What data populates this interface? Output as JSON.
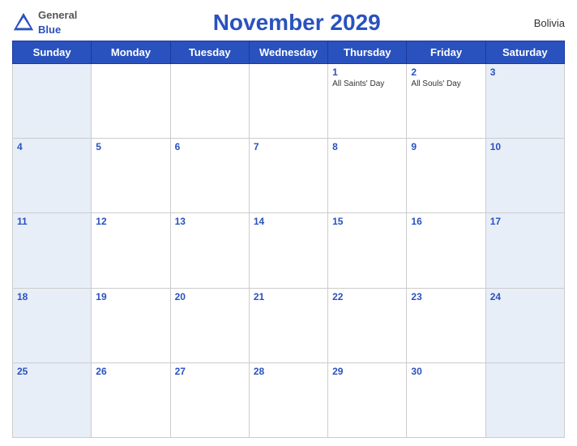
{
  "header": {
    "title": "November 2029",
    "country": "Bolivia",
    "logo": {
      "general": "General",
      "blue": "Blue"
    }
  },
  "weekdays": [
    "Sunday",
    "Monday",
    "Tuesday",
    "Wednesday",
    "Thursday",
    "Friday",
    "Saturday"
  ],
  "weeks": [
    [
      {
        "day": "",
        "events": []
      },
      {
        "day": "",
        "events": []
      },
      {
        "day": "",
        "events": []
      },
      {
        "day": "",
        "events": []
      },
      {
        "day": "1",
        "events": [
          "All Saints' Day"
        ]
      },
      {
        "day": "2",
        "events": [
          "All Souls' Day"
        ]
      },
      {
        "day": "3",
        "events": []
      }
    ],
    [
      {
        "day": "4",
        "events": []
      },
      {
        "day": "5",
        "events": []
      },
      {
        "day": "6",
        "events": []
      },
      {
        "day": "7",
        "events": []
      },
      {
        "day": "8",
        "events": []
      },
      {
        "day": "9",
        "events": []
      },
      {
        "day": "10",
        "events": []
      }
    ],
    [
      {
        "day": "11",
        "events": []
      },
      {
        "day": "12",
        "events": []
      },
      {
        "day": "13",
        "events": []
      },
      {
        "day": "14",
        "events": []
      },
      {
        "day": "15",
        "events": []
      },
      {
        "day": "16",
        "events": []
      },
      {
        "day": "17",
        "events": []
      }
    ],
    [
      {
        "day": "18",
        "events": []
      },
      {
        "day": "19",
        "events": []
      },
      {
        "day": "20",
        "events": []
      },
      {
        "day": "21",
        "events": []
      },
      {
        "day": "22",
        "events": []
      },
      {
        "day": "23",
        "events": []
      },
      {
        "day": "24",
        "events": []
      }
    ],
    [
      {
        "day": "25",
        "events": []
      },
      {
        "day": "26",
        "events": []
      },
      {
        "day": "27",
        "events": []
      },
      {
        "day": "28",
        "events": []
      },
      {
        "day": "29",
        "events": []
      },
      {
        "day": "30",
        "events": []
      },
      {
        "day": "",
        "events": []
      }
    ]
  ],
  "colors": {
    "header_bg": "#2a52be",
    "weekend_bg": "#e8eef8",
    "day_number": "#2a52be"
  }
}
